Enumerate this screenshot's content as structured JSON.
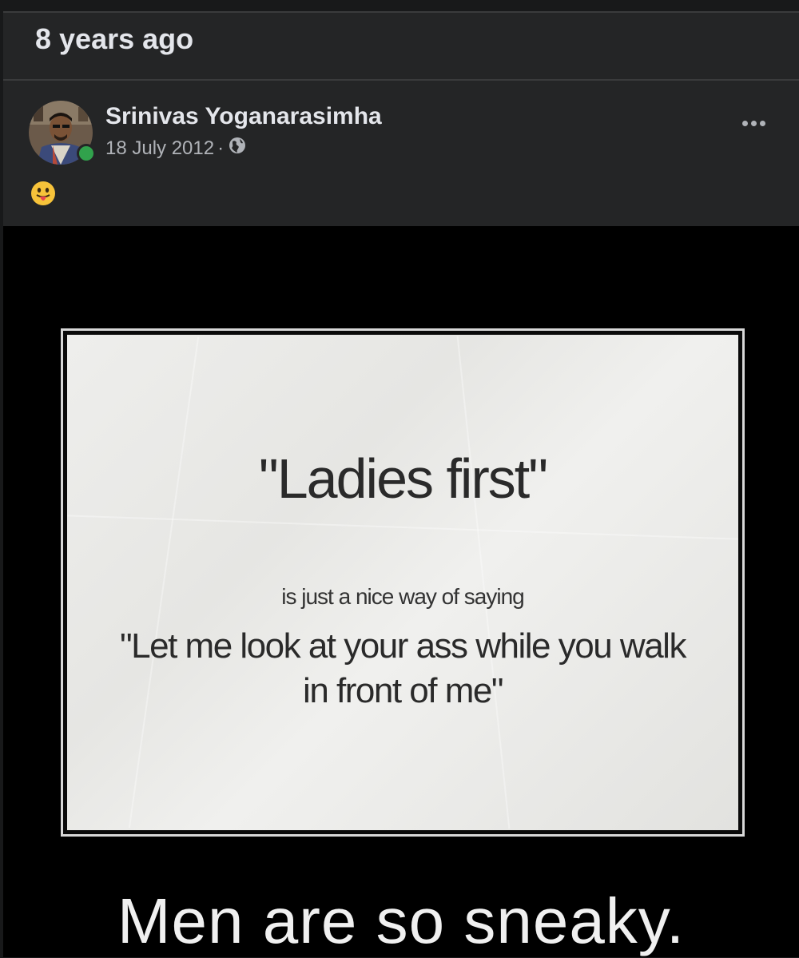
{
  "memory": {
    "title": "8 years ago"
  },
  "post": {
    "author": "Srinivas Yoganarasimha",
    "date": "18 July 2012",
    "separator": "·",
    "privacy_icon": "globe-icon",
    "text_emoji": "face-with-tongue",
    "more_icon": "more-options-icon",
    "online_color": "#31a24c"
  },
  "image": {
    "headline": "\"Ladies first\"",
    "subline": "is just a nice way of saying",
    "quote": "\"Let me look at your ass while you walk in front of me\"",
    "caption": "Men are so sneaky."
  }
}
